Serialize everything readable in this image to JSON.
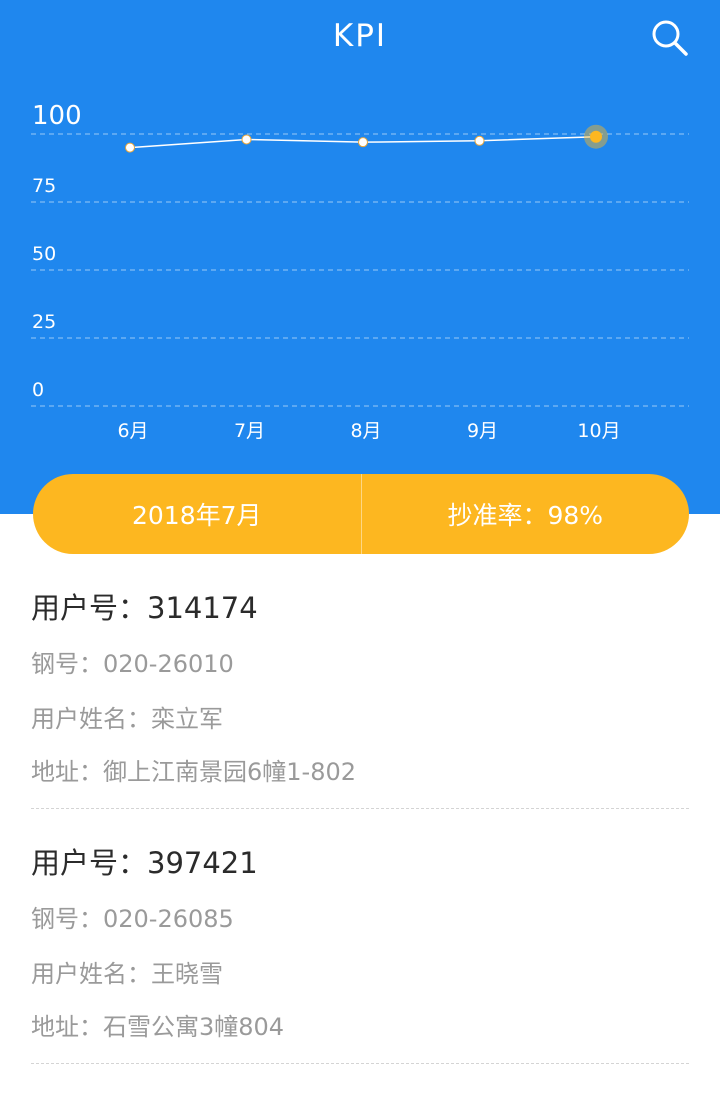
{
  "header": {
    "title": "KPI"
  },
  "chart_data": {
    "type": "line",
    "categories": [
      "6月",
      "7月",
      "8月",
      "9月",
      "10月"
    ],
    "values": [
      95,
      98,
      97,
      97.5,
      99
    ],
    "y_ticks": [
      "100",
      "75",
      "50",
      "25",
      "0"
    ],
    "ylim": [
      0,
      100
    ],
    "highlight_index": 4,
    "grid": "dashed",
    "line_color": "#ffffff",
    "highlight_color": "#fdb720"
  },
  "summary": {
    "date": "2018年7月",
    "rate": "抄准率：98%"
  },
  "records": [
    {
      "user_no": "用户号：314174",
      "meter_no": "钢号：020-26010",
      "name": "用户姓名：栾立军",
      "address": "地址：御上江南景园6幢1-802"
    },
    {
      "user_no": "用户号：397421",
      "meter_no": "钢号：020-26085",
      "name": "用户姓名：王晓雪",
      "address": "地址：石雪公寓3幢804"
    }
  ],
  "colors": {
    "header_bg": "#1f87ee",
    "accent": "#fdb720",
    "primary_text": "#2b2b2b",
    "secondary_text": "#9a9a9a"
  },
  "icons": {
    "search": "search-icon"
  }
}
